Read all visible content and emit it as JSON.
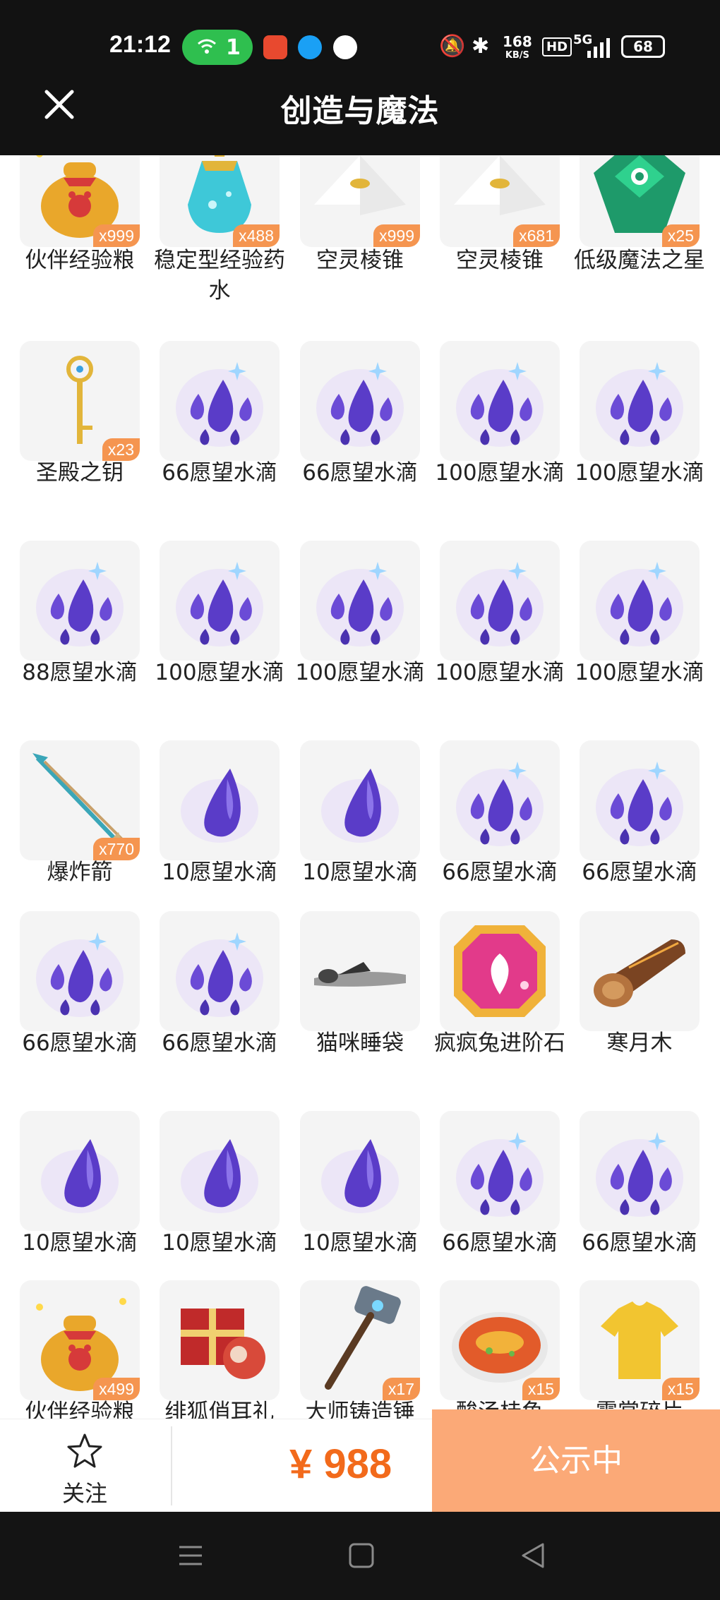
{
  "status_bar": {
    "time": "21:12",
    "hotspot_count": "1",
    "network_speed_top": "168",
    "network_speed_unit": "KB/S",
    "hd_label": "HD",
    "network_type": "5G",
    "battery": "68"
  },
  "header": {
    "title": "创造与魔法",
    "close_icon": "close-icon"
  },
  "items": [
    {
      "label": "伙伴经验粮",
      "qty": "x999",
      "icon": "bag"
    },
    {
      "label": "稳定型经验药水",
      "qty": "x488",
      "icon": "potion"
    },
    {
      "label": "空灵棱锥",
      "qty": "x999",
      "icon": "pyramid"
    },
    {
      "label": "空灵棱锥",
      "qty": "x681",
      "icon": "pyramid"
    },
    {
      "label": "低级魔法之星",
      "qty": "x25",
      "icon": "gem-green"
    },
    {
      "label": "圣殿之钥",
      "qty": "x23",
      "icon": "key"
    },
    {
      "label": "66愿望水滴",
      "qty": "",
      "icon": "drops"
    },
    {
      "label": "66愿望水滴",
      "qty": "",
      "icon": "drops"
    },
    {
      "label": "100愿望水滴",
      "qty": "",
      "icon": "drops"
    },
    {
      "label": "100愿望水滴",
      "qty": "",
      "icon": "drops"
    },
    {
      "label": "88愿望水滴",
      "qty": "",
      "icon": "drops"
    },
    {
      "label": "100愿望水滴",
      "qty": "",
      "icon": "drops"
    },
    {
      "label": "100愿望水滴",
      "qty": "",
      "icon": "drops"
    },
    {
      "label": "100愿望水滴",
      "qty": "",
      "icon": "drops"
    },
    {
      "label": "100愿望水滴",
      "qty": "",
      "icon": "drops"
    },
    {
      "label": "爆炸箭",
      "qty": "x770",
      "icon": "arrow"
    },
    {
      "label": "10愿望水滴",
      "qty": "",
      "icon": "drop"
    },
    {
      "label": "10愿望水滴",
      "qty": "",
      "icon": "drop"
    },
    {
      "label": "66愿望水滴",
      "qty": "",
      "icon": "drops"
    },
    {
      "label": "66愿望水滴",
      "qty": "",
      "icon": "drops"
    },
    {
      "label": "66愿望水滴",
      "qty": "",
      "icon": "drops"
    },
    {
      "label": "66愿望水滴",
      "qty": "",
      "icon": "drops"
    },
    {
      "label": "猫咪睡袋",
      "qty": "",
      "icon": "sleepbag"
    },
    {
      "label": "疯疯兔进阶石",
      "qty": "",
      "icon": "gem-pink"
    },
    {
      "label": "寒月木",
      "qty": "",
      "icon": "log"
    },
    {
      "label": "10愿望水滴",
      "qty": "",
      "icon": "drop"
    },
    {
      "label": "10愿望水滴",
      "qty": "",
      "icon": "drop"
    },
    {
      "label": "10愿望水滴",
      "qty": "",
      "icon": "drop"
    },
    {
      "label": "66愿望水滴",
      "qty": "",
      "icon": "drops"
    },
    {
      "label": "66愿望水滴",
      "qty": "",
      "icon": "drops"
    },
    {
      "label": "伙伴经验粮",
      "qty": "x499",
      "icon": "bag"
    },
    {
      "label": "绯狐俏耳礼",
      "qty": "",
      "icon": "giftbox"
    },
    {
      "label": "大师铸造锤",
      "qty": "x17",
      "icon": "hammer"
    },
    {
      "label": "酸汤桂鱼",
      "qty": "x15",
      "icon": "fish"
    },
    {
      "label": "霓裳碎片",
      "qty": "x15",
      "icon": "shirt"
    }
  ],
  "action_bar": {
    "follow_label": "关注",
    "price": "¥ 988",
    "status_button": "公示中"
  },
  "colors": {
    "accent_orange": "#f26a1b",
    "status_button_bg": "#fba977",
    "qty_badge_bg": "#f59550",
    "topbar_bg": "#121212"
  }
}
